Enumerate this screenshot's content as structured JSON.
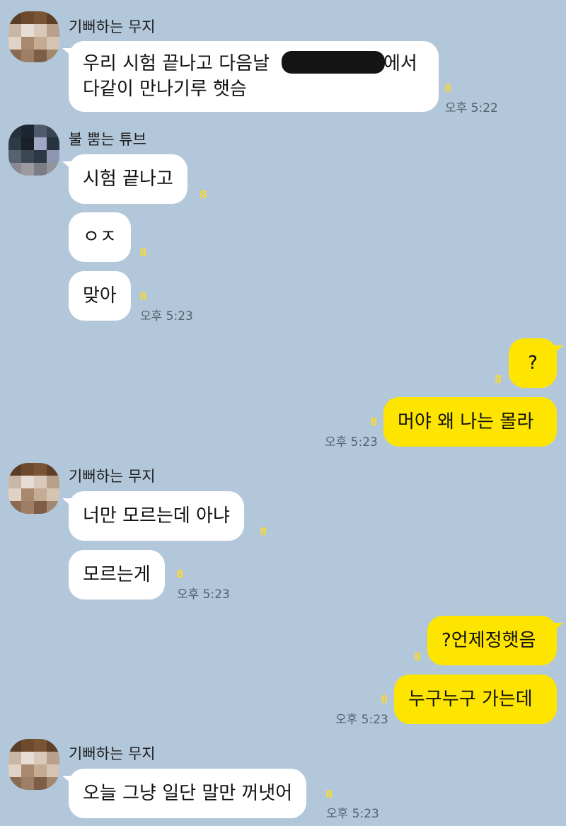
{
  "colors": {
    "background": "#b2c7da",
    "incoming_bubble": "#ffffff",
    "outgoing_bubble": "#fee500",
    "unread": "#f5d83b",
    "time": "#556170"
  },
  "messages": [
    {
      "sender": "기뻐하는 무지",
      "lines": [
        "우리 시험 끝나고 다음날",
        "다같이 만나기루 햇슴"
      ],
      "redacted_tail": "에서",
      "unread": "8",
      "time": "오후 5:22"
    },
    {
      "sender": "불 뿜는 튜브",
      "text": "시험 끝나고",
      "unread": "8"
    },
    {
      "text": "ㅇㅈ",
      "unread": "8"
    },
    {
      "text": "맞아",
      "unread": "8",
      "time": "오후 5:23"
    },
    {
      "text": "?",
      "unread": "8"
    },
    {
      "text": "머야 왜 나는 몰라",
      "unread": "8",
      "time": "오후 5:23"
    },
    {
      "sender": "기뻐하는 무지",
      "text": "너만 모르는데 아냐",
      "unread": "8"
    },
    {
      "text": "모르는게",
      "unread": "8",
      "time": "오후 5:23"
    },
    {
      "text": "?언제정햇음",
      "unread": "8"
    },
    {
      "text": "누구누구 가는데",
      "unread": "8",
      "time": "오후 5:23"
    },
    {
      "sender": "기뻐하는 무지",
      "text": "오늘 그냥 일단 말만 꺼냇어",
      "unread": "8",
      "time": "오후 5:23"
    }
  ]
}
